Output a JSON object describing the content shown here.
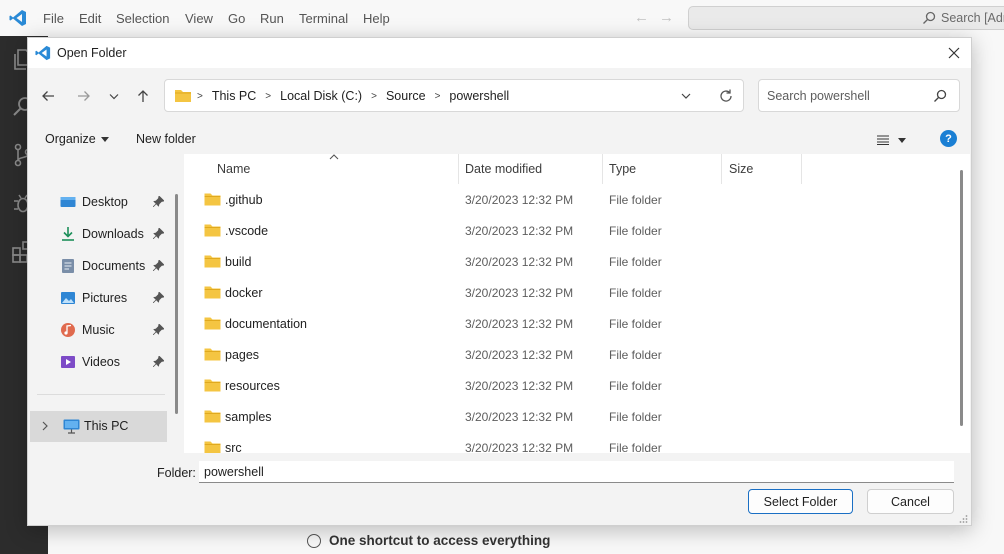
{
  "vscode": {
    "menu": [
      "File",
      "Edit",
      "Selection",
      "View",
      "Go",
      "Run",
      "Terminal",
      "Help"
    ],
    "search_placeholder": "Search [Adm",
    "walkthrough_item": "One shortcut to access everything"
  },
  "dialog": {
    "title": "Open Folder",
    "breadcrumbs": [
      "This PC",
      "Local Disk (C:)",
      "Source",
      "powershell"
    ],
    "search_placeholder": "Search powershell",
    "organize_label": "Organize",
    "new_folder_label": "New folder",
    "help_label": "?",
    "quick_access": [
      {
        "label": "Desktop",
        "icon": "desktop-icon"
      },
      {
        "label": "Downloads",
        "icon": "downloads-icon"
      },
      {
        "label": "Documents",
        "icon": "documents-icon"
      },
      {
        "label": "Pictures",
        "icon": "pictures-icon"
      },
      {
        "label": "Music",
        "icon": "music-icon"
      },
      {
        "label": "Videos",
        "icon": "videos-icon"
      }
    ],
    "this_pc_label": "This PC",
    "columns": {
      "name": "Name",
      "date": "Date modified",
      "type": "Type",
      "size": "Size"
    },
    "files": [
      {
        "name": ".github",
        "date": "3/20/2023 12:32 PM",
        "type": "File folder"
      },
      {
        "name": ".vscode",
        "date": "3/20/2023 12:32 PM",
        "type": "File folder"
      },
      {
        "name": "build",
        "date": "3/20/2023 12:32 PM",
        "type": "File folder"
      },
      {
        "name": "docker",
        "date": "3/20/2023 12:32 PM",
        "type": "File folder"
      },
      {
        "name": "documentation",
        "date": "3/20/2023 12:32 PM",
        "type": "File folder"
      },
      {
        "name": "pages",
        "date": "3/20/2023 12:32 PM",
        "type": "File folder"
      },
      {
        "name": "resources",
        "date": "3/20/2023 12:32 PM",
        "type": "File folder"
      },
      {
        "name": "samples",
        "date": "3/20/2023 12:32 PM",
        "type": "File folder"
      },
      {
        "name": "src",
        "date": "3/20/2023 12:32 PM",
        "type": "File folder"
      }
    ],
    "folder_label": "Folder:",
    "folder_value": "powershell",
    "select_label": "Select Folder",
    "cancel_label": "Cancel"
  },
  "colors": {
    "accent": "#1a7fd4",
    "folder": "#f4c542",
    "activity_bar": "#2c2c2c"
  }
}
